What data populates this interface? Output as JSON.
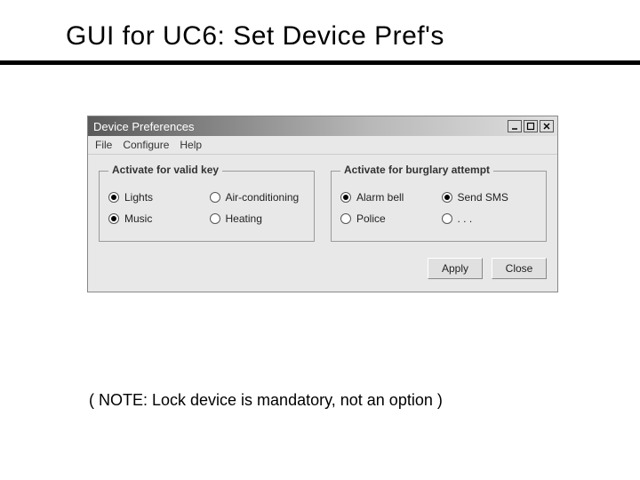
{
  "slide": {
    "title": "GUI for UC6: Set Device Pref's",
    "note": "( NOTE: Lock device is mandatory, not an option )"
  },
  "window": {
    "title": "Device Preferences",
    "menus": {
      "file": "File",
      "configure": "Configure",
      "help": "Help"
    },
    "groups": {
      "valid": {
        "legend": "Activate for valid key",
        "options": [
          {
            "label": "Lights",
            "selected": true
          },
          {
            "label": "Air-conditioning",
            "selected": false
          },
          {
            "label": "Music",
            "selected": true
          },
          {
            "label": "Heating",
            "selected": false
          }
        ]
      },
      "burglary": {
        "legend": "Activate for burglary attempt",
        "options": [
          {
            "label": "Alarm bell",
            "selected": true
          },
          {
            "label": "Send SMS",
            "selected": true
          },
          {
            "label": "Police",
            "selected": false
          },
          {
            "label": ". . .",
            "selected": false
          }
        ]
      }
    },
    "buttons": {
      "apply": "Apply",
      "close": "Close"
    }
  }
}
